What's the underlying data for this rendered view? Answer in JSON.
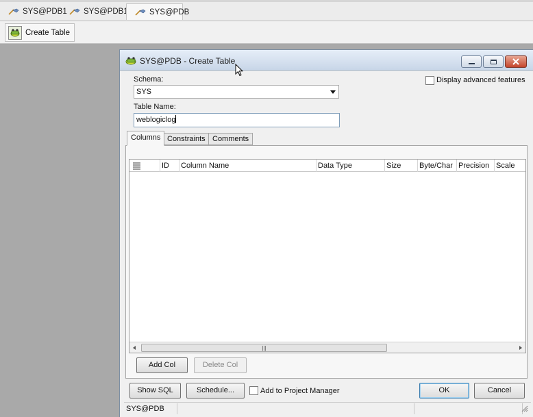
{
  "session_tabs": [
    {
      "label": "SYS@PDB1"
    },
    {
      "label": "SYS@PDB1"
    },
    {
      "label": "SYS@PDB"
    }
  ],
  "toolbar": {
    "create_table_label": "Create Table"
  },
  "dialog": {
    "title": "SYS@PDB - Create Table",
    "schema_label": "Schema:",
    "schema_value": "SYS",
    "table_name_label": "Table Name:",
    "table_name_value": "weblogiclog",
    "advanced_label": "Display advanced features",
    "tabs": [
      {
        "label": "Columns"
      },
      {
        "label": "Constraints"
      },
      {
        "label": "Comments"
      }
    ],
    "columns_header": [
      "ID",
      "Column Name",
      "Data Type",
      "Size",
      "Byte/Char",
      "Precision",
      "Scale"
    ],
    "add_col_label": "Add Col",
    "delete_col_label": "Delete Col",
    "show_sql_label": "Show SQL",
    "schedule_label": "Schedule...",
    "project_manager_label": "Add to Project Manager",
    "ok_label": "OK",
    "cancel_label": "Cancel",
    "status_connection": "SYS@PDB"
  }
}
